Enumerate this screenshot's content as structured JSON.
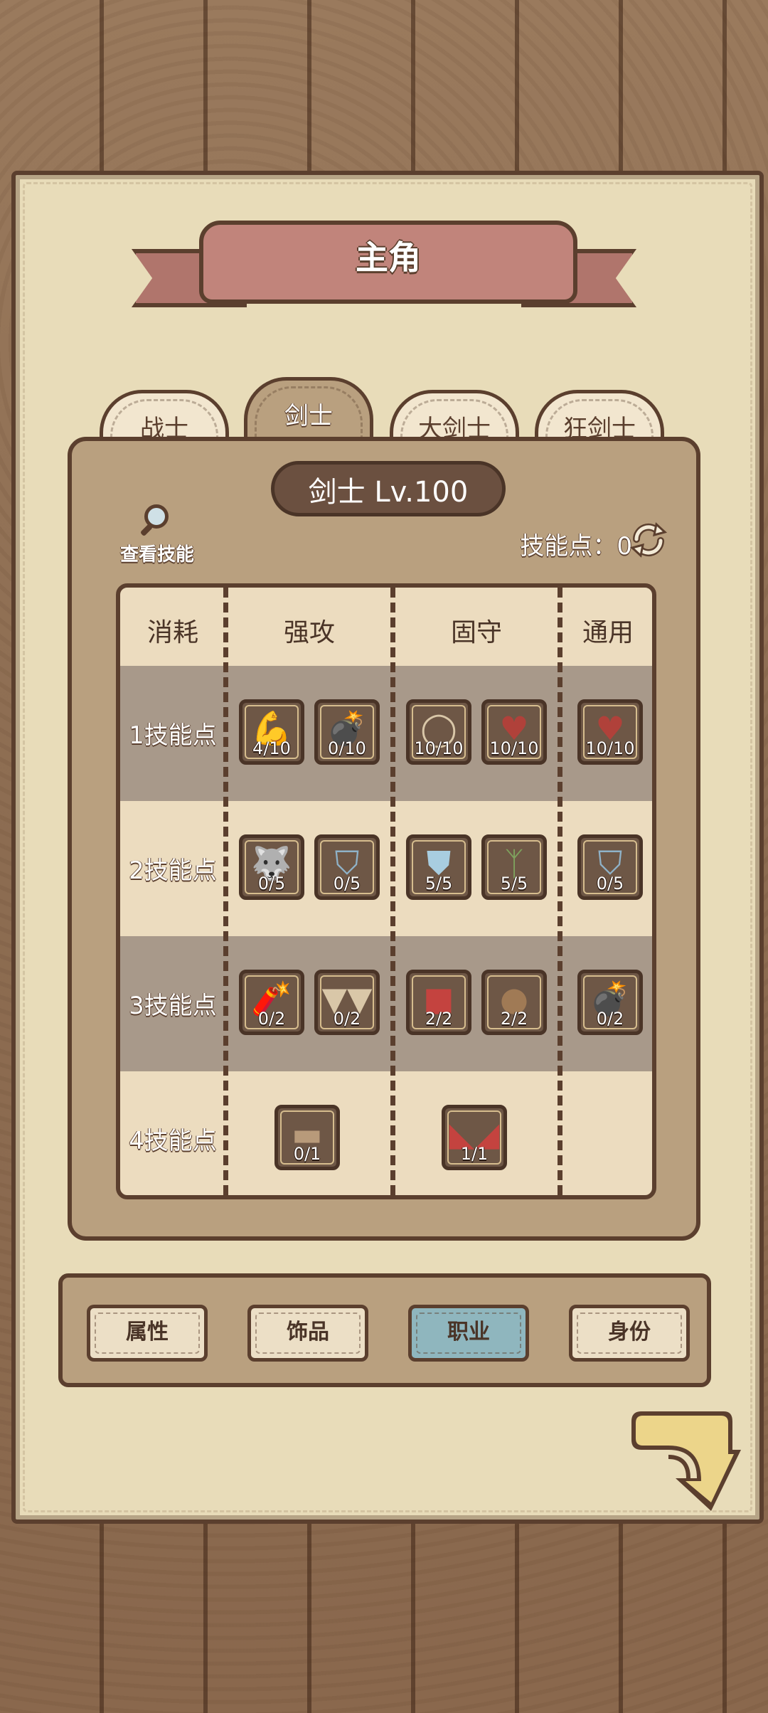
{
  "header": {
    "title": "主角"
  },
  "tabs": [
    {
      "label": "战士"
    },
    {
      "label": "剑士"
    },
    {
      "label": "大剑士"
    },
    {
      "label": "狂剑士"
    }
  ],
  "panel": {
    "class_level": "剑士 Lv.100",
    "view_skills": "查看技能",
    "skill_points_label": "技能点：0"
  },
  "grid": {
    "headers": [
      "消耗",
      "强攻",
      "固守",
      "通用"
    ],
    "rows": [
      {
        "label": "1技能点"
      },
      {
        "label": "2技能点"
      },
      {
        "label": "3技能点"
      },
      {
        "label": "4技能点"
      }
    ],
    "skills": [
      {
        "icon": "muscle-arm-icon",
        "level": "4/10"
      },
      {
        "icon": "bomb-skull-icon",
        "level": "0/10"
      },
      {
        "icon": "shield-ring-icon",
        "level": "10/10"
      },
      {
        "icon": "heart-icon",
        "level": "10/10"
      },
      {
        "icon": "heart-up-icon",
        "level": "10/10"
      },
      {
        "icon": "beast-head-icon",
        "level": "0/5"
      },
      {
        "icon": "broken-shield-icon",
        "level": "0/5"
      },
      {
        "icon": "crystal-shield-icon",
        "level": "5/5"
      },
      {
        "icon": "grass-icon",
        "level": "5/5"
      },
      {
        "icon": "broken-shield-up-icon",
        "level": "0/5"
      },
      {
        "icon": "dynamite-icon",
        "level": "0/2"
      },
      {
        "icon": "fangs-icon",
        "level": "0/2"
      },
      {
        "icon": "meat-icon",
        "level": "2/2"
      },
      {
        "icon": "wooden-shield-icon",
        "level": "2/2"
      },
      {
        "icon": "bomb-skull-up-icon",
        "level": "0/2"
      },
      {
        "icon": "scroll-icon",
        "level": "0/1"
      },
      {
        "icon": "red-eyes-icon",
        "level": "1/1"
      }
    ]
  },
  "nav": [
    {
      "label": "属性"
    },
    {
      "label": "饰品"
    },
    {
      "label": "职业"
    },
    {
      "label": "身份"
    }
  ],
  "colors": {
    "paper": "#e8dcb9",
    "border": "#5b3f2e",
    "panel": "#b9a07f",
    "active_nav": "#8fb6be",
    "ribbon": "#c1847b"
  }
}
